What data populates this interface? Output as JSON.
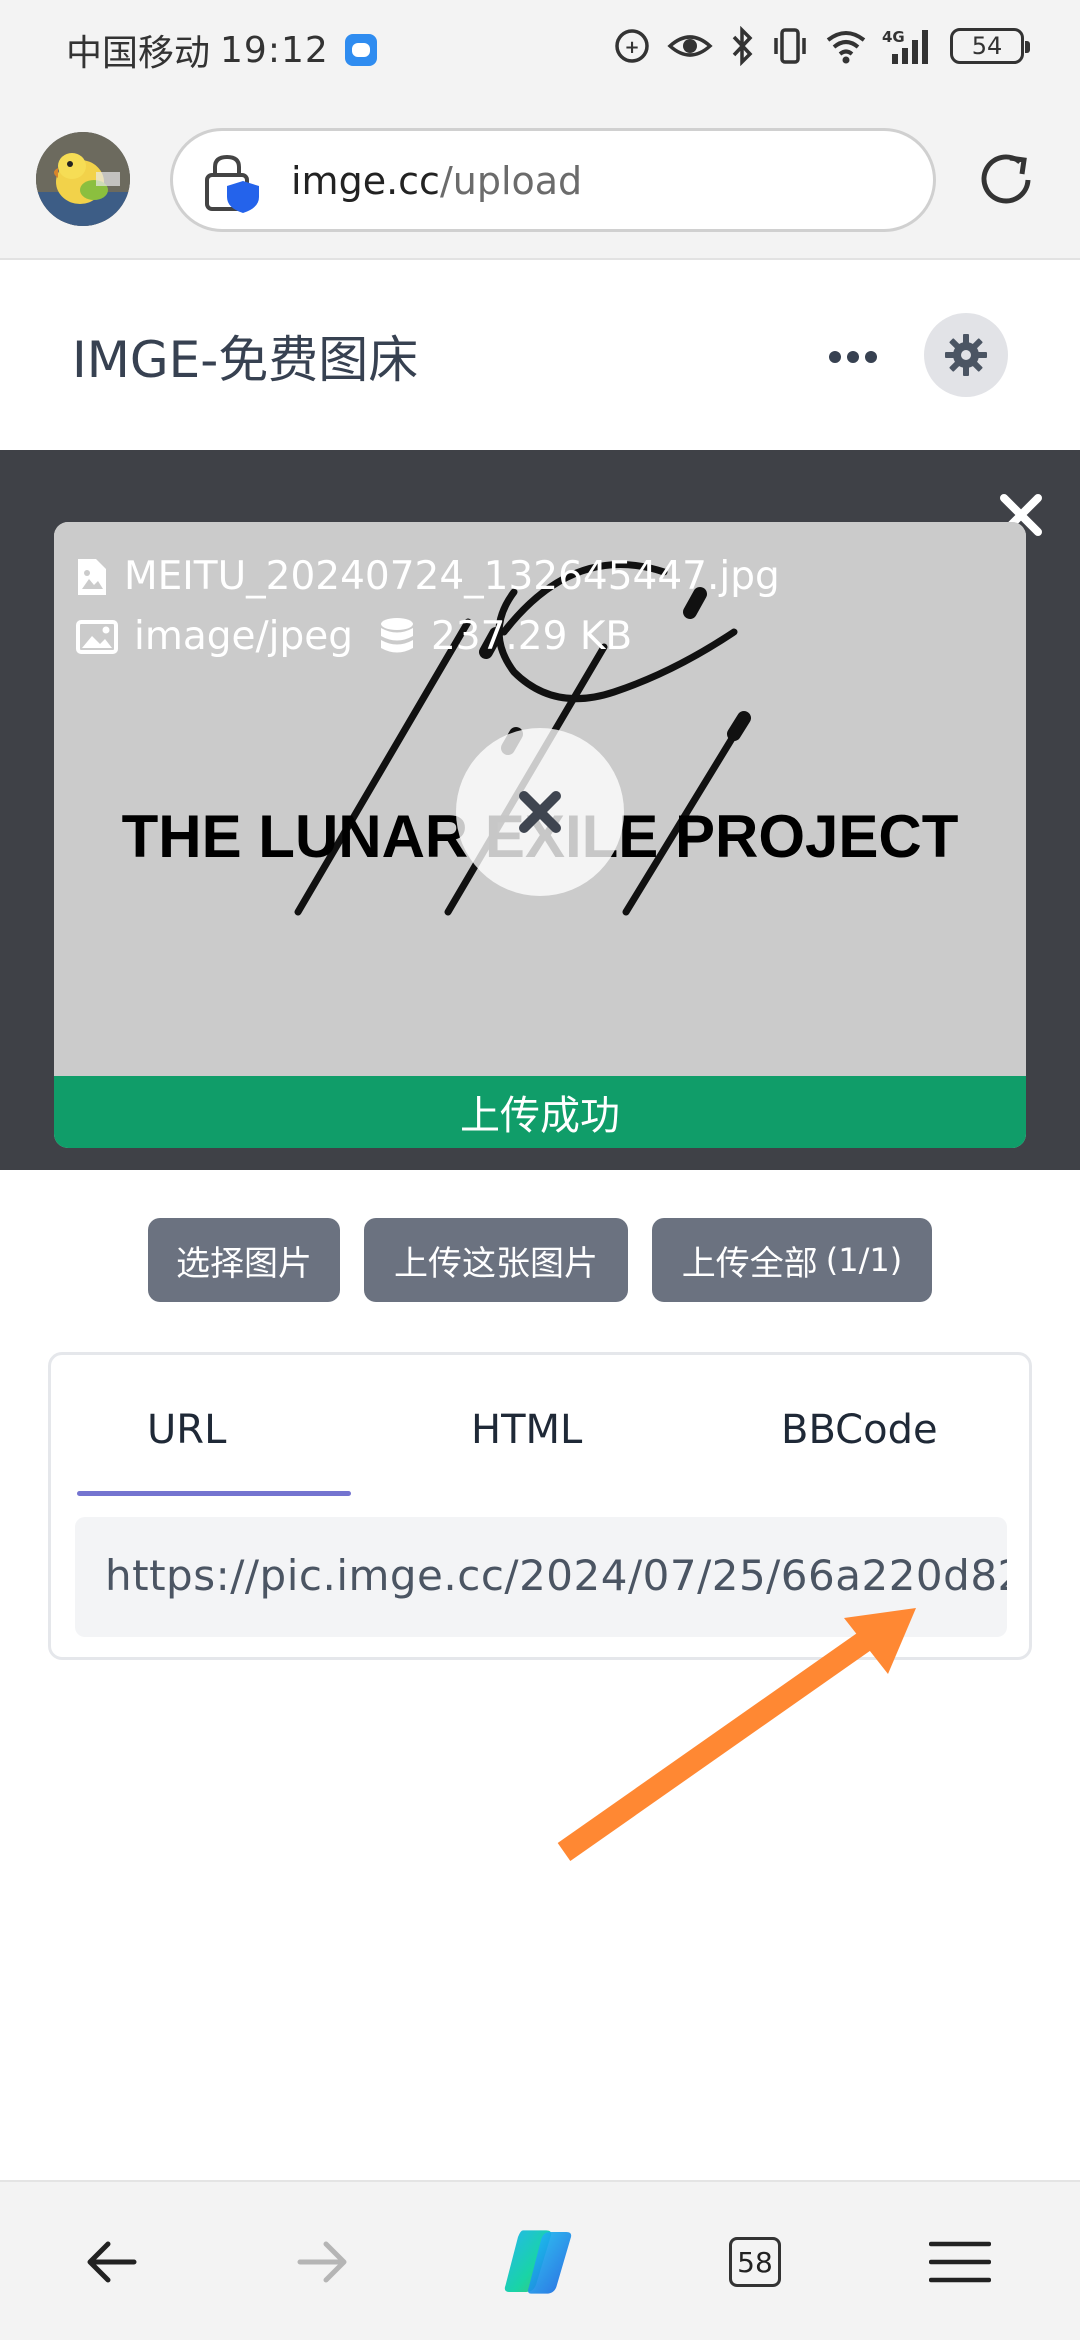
{
  "status_bar": {
    "carrier": "中国移动",
    "time": "19:12",
    "network": "4G",
    "battery": "54"
  },
  "browser": {
    "url_domain": "imge.cc",
    "url_path": "/upload",
    "tab_count": "58"
  },
  "site": {
    "title": "IMGE-免费图床"
  },
  "upload": {
    "file_name": "MEITU_20240724_132645447.jpg",
    "mime_type": "image/jpeg",
    "file_size": "237.29 KB",
    "preview_text": "THE LUNAR EXILE PROJECT",
    "status": "上传成功"
  },
  "actions": {
    "choose_label": "选择图片",
    "upload_this_label": "上传这张图片",
    "upload_all_label": "上传全部",
    "upload_all_count": "(1/1)"
  },
  "result": {
    "tabs": [
      "URL",
      "HTML",
      "BBCode"
    ],
    "active_tab": "URL",
    "url_value": "https://pic.imge.cc/2024/07/25/66a220d82"
  },
  "colors": {
    "accent": "#7474d0",
    "success": "#109d69",
    "button": "#6b7280",
    "dark_panel": "#3f4147",
    "annotation_arrow": "#ff8833"
  }
}
